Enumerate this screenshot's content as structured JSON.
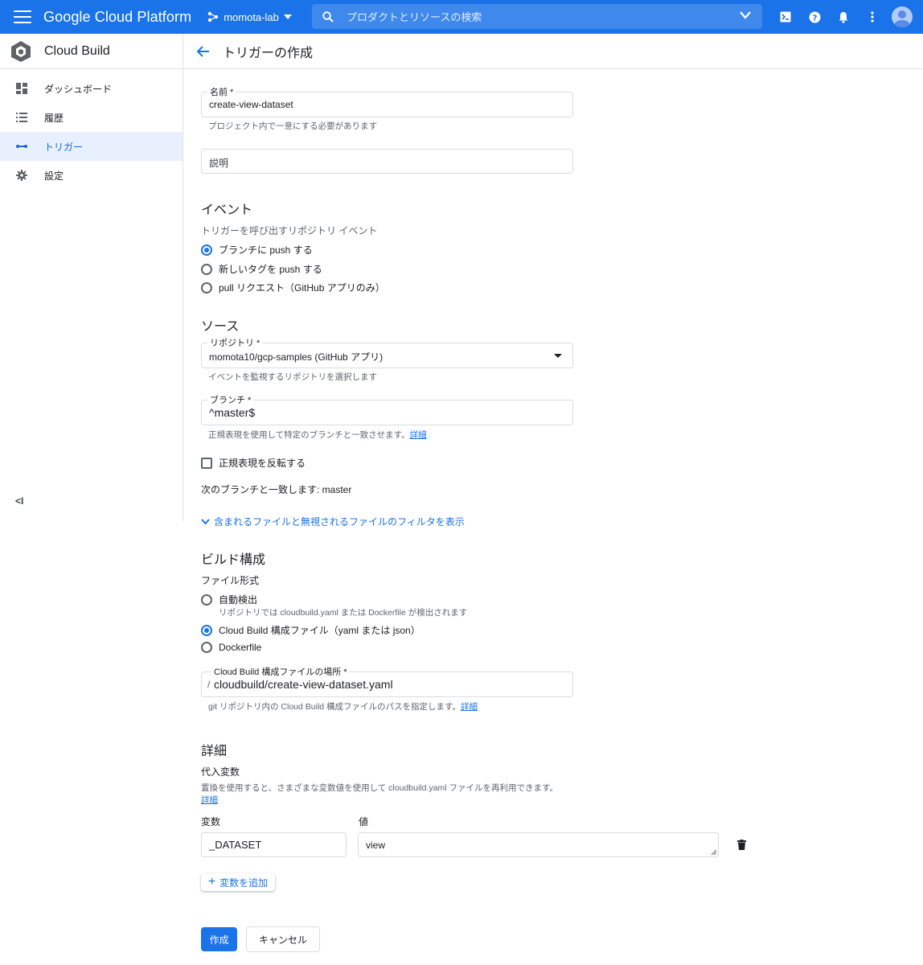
{
  "topbar": {
    "brand": "Google Cloud Platform",
    "project": "momota-lab",
    "search_placeholder": "プロダクトとリソースの検索",
    "bg_color": "#1a73e8"
  },
  "sidebar": {
    "product_name": "Cloud Build",
    "items": [
      {
        "label": "ダッシュボード",
        "icon": "dashboard-icon"
      },
      {
        "label": "履歴",
        "icon": "list-icon"
      },
      {
        "label": "トリガー",
        "icon": "trigger-icon",
        "active": true
      },
      {
        "label": "設定",
        "icon": "gear-icon"
      }
    ],
    "collapse_label": "<I"
  },
  "header": {
    "title": "トリガーの作成"
  },
  "form": {
    "name": {
      "label": "名前 *",
      "value": "create-view-dataset",
      "hint": "プロジェクト内で一意にする必要があります"
    },
    "description": {
      "placeholder": "説明"
    },
    "event": {
      "title": "イベント",
      "desc": "トリガーを呼び出すリポジトリ イベント",
      "options": [
        {
          "label": "ブランチに push する",
          "selected": true
        },
        {
          "label": "新しいタグを push する",
          "selected": false
        },
        {
          "label": "pull リクエスト（GitHub アプリのみ）",
          "selected": false
        }
      ]
    },
    "source": {
      "title": "ソース",
      "repo": {
        "label": "リポジトリ *",
        "value": "momota10/gcp-samples (GitHub アプリ)",
        "hint": "イベントを監視するリポジトリを選択します"
      },
      "branch": {
        "label": "ブランチ *",
        "value": "^master$",
        "hint": "正規表現を使用して特定のブランチと一致させます。",
        "hint_link": "詳細"
      },
      "invert_label": "正規表現を反転する",
      "match_text": "次のブランチと一致します: master",
      "filter_toggle": "含まれるファイルと無視されるファイルのフィルタを表示"
    },
    "build": {
      "title": "ビルド構成",
      "file_type_label": "ファイル形式",
      "options": [
        {
          "label": "自動検出",
          "sub": "リポジトリでは cloudbuild.yaml または Dockerfile が検出されます",
          "selected": false
        },
        {
          "label": "Cloud Build 構成ファイル（yaml または json）",
          "sub": "",
          "selected": true
        },
        {
          "label": "Dockerfile",
          "sub": "",
          "selected": false
        }
      ],
      "location": {
        "label": "Cloud Build 構成ファイルの場所 *",
        "prefix": "/",
        "value": "cloudbuild/create-view-dataset.yaml",
        "hint": "git リポジトリ内の Cloud Build 構成ファイルのパスを指定します。",
        "hint_link": "詳細"
      }
    },
    "details": {
      "title": "詳細",
      "subs_label": "代入変数",
      "subs_desc": "置換を使用すると、さまざまな変数値を使用して cloudbuild.yaml ファイルを再利用できます。",
      "subs_link": "詳細",
      "col_var": "変数",
      "col_val": "値",
      "rows": [
        {
          "variable": "_DATASET",
          "value": "view"
        }
      ],
      "add_label": "変数を追加"
    },
    "create_label": "作成",
    "cancel_label": "キャンセル"
  }
}
